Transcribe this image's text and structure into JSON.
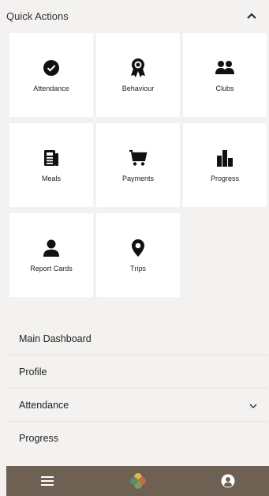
{
  "quick_actions": {
    "title": "Quick Actions",
    "collapse_icon": "chevron-up-icon",
    "tiles": [
      {
        "label": "Attendance",
        "icon": "check-circle-icon"
      },
      {
        "label": "Behaviour",
        "icon": "award-ribbon-icon"
      },
      {
        "label": "Clubs",
        "icon": "users-group-icon"
      },
      {
        "label": "Meals",
        "icon": "newspaper-icon"
      },
      {
        "label": "Payments",
        "icon": "shopping-cart-icon"
      },
      {
        "label": "Progress",
        "icon": "bar-chart-icon"
      },
      {
        "label": "Report Cards",
        "icon": "user-icon"
      },
      {
        "label": "Trips",
        "icon": "map-pin-icon"
      }
    ]
  },
  "menu": {
    "items": [
      {
        "label": "Main Dashboard"
      },
      {
        "label": "Profile"
      },
      {
        "label": "Attendance",
        "icon": "chevron-down-icon"
      },
      {
        "label": "Progress"
      }
    ]
  },
  "bottom_bar": {
    "background": "#6e6053",
    "left_icon": "hamburger-menu-icon",
    "center_icon": "clover-logo-icon",
    "right_icon": "account-circle-icon"
  }
}
